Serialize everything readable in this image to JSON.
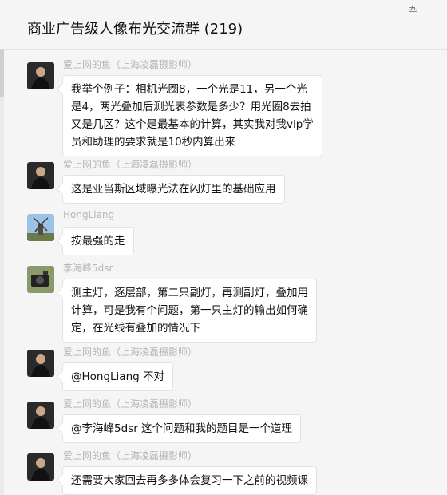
{
  "header": {
    "title": "商业广告级人像布光交流群 (219)",
    "pin_icon": "pin-icon"
  },
  "messages": [
    {
      "sender": "爱上网的鱼（上海凌磊摄影师）",
      "text": "我举个例子：相机光圈8，一个光是11，另一个光\n是4，两光叠加后测光表参数是多少？用光圈8去拍\n又是几区？这个是最基本的计算，其实我对我vip学\n员和助理的要求就是10秒内算出来",
      "avatar": "man-in-black-avatar"
    },
    {
      "sender": "爱上网的鱼（上海凌磊摄影师）",
      "text": "这是亚当斯区域曝光法在闪灯里的基础应用",
      "avatar": "man-in-black-avatar"
    },
    {
      "sender": "HongLiang",
      "text": "按最强的走",
      "avatar": "windmill-avatar"
    },
    {
      "sender": "李海峰5dsr",
      "text": "测主灯，逐层部，第二只副灯，再测副灯，叠加用\n计算，可是我有个问题，第一只主灯的输出如何确\n定，在光线有叠加的情况下",
      "avatar": "camera-avatar"
    },
    {
      "sender": "爱上网的鱼（上海凌磊摄影师）",
      "text": "@HongLiang 不对",
      "avatar": "man-in-black-avatar"
    },
    {
      "sender": "爱上网的鱼（上海凌磊摄影师）",
      "text": "@李海峰5dsr 这个问题和我的题目是一个道理",
      "avatar": "man-in-black-avatar"
    },
    {
      "sender": "爱上网的鱼（上海凌磊摄影师）",
      "text": "还需要大家回去再多多体会复习一下之前的视频课",
      "avatar": "man-in-black-avatar"
    }
  ]
}
